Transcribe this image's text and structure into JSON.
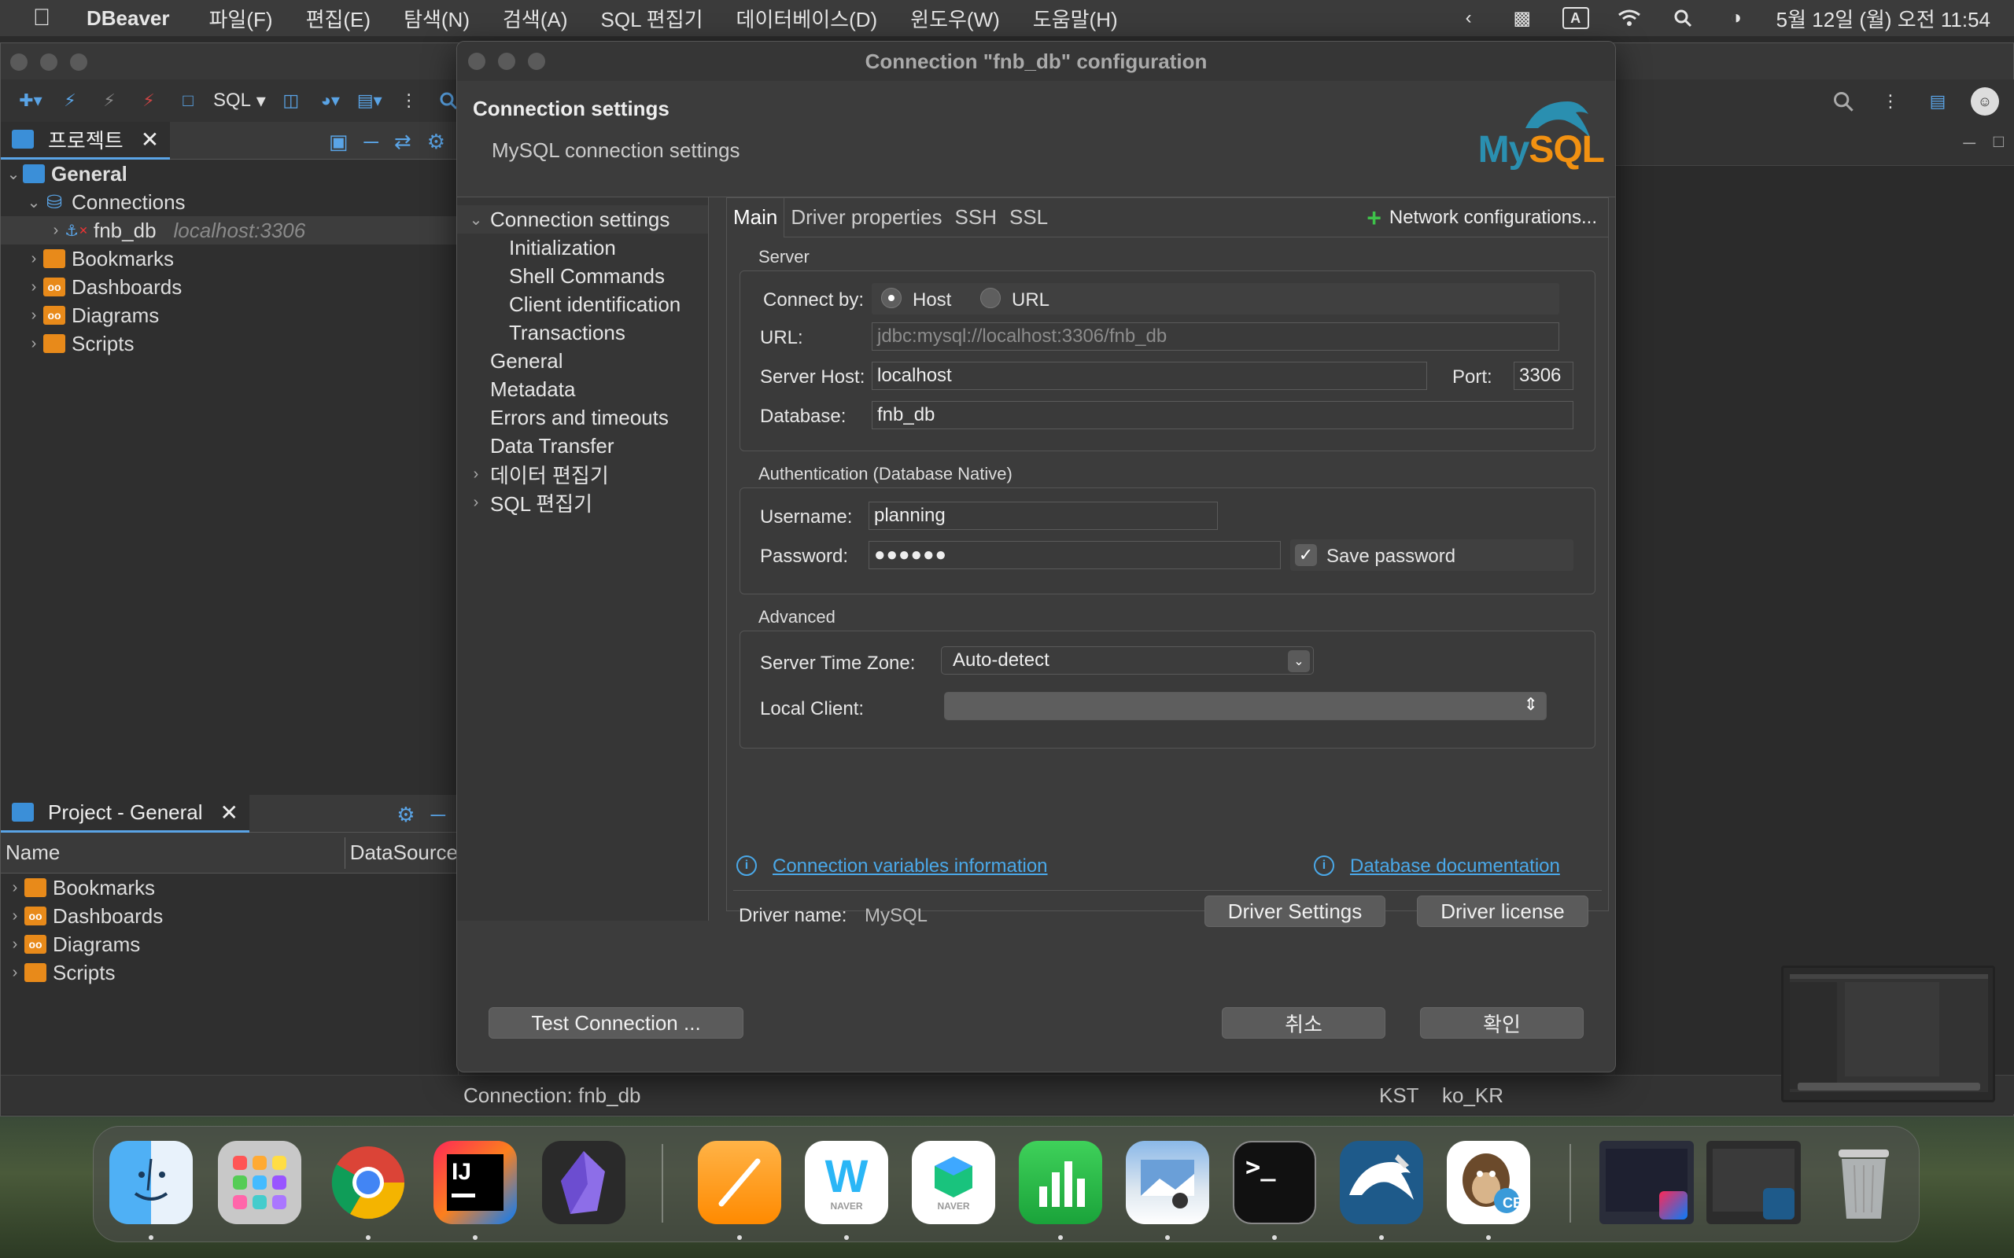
{
  "menubar": {
    "app_name": "DBeaver",
    "items": [
      "파일(F)",
      "편집(E)",
      "탐색(N)",
      "검색(A)",
      "SQL 편집기",
      "데이터베이스(D)",
      "윈도우(W)",
      "도움말(H)"
    ],
    "input_mode": "A",
    "clock": "5월 12일 (월) 오전 11:54"
  },
  "toolbar": {
    "sql_label": "SQL"
  },
  "project_panel": {
    "tab_label": "프로젝트",
    "tree": {
      "root": "General",
      "connections": "Connections",
      "connection_name": "fnb_db",
      "connection_host": "localhost:3306",
      "bookmarks": "Bookmarks",
      "dashboards": "Dashboards",
      "diagrams": "Diagrams",
      "scripts": "Scripts"
    },
    "folder_icon_text": "oo"
  },
  "project_general_panel": {
    "tab_label": "Project - General",
    "columns": [
      "Name",
      "DataSource"
    ],
    "items": [
      "Bookmarks",
      "Dashboards",
      "Diagrams",
      "Scripts"
    ]
  },
  "status_bar": {
    "connection": "Connection: fnb_db",
    "timezone": "KST",
    "locale": "ko_KR"
  },
  "dialog": {
    "title": "Connection \"fnb_db\" configuration",
    "header_title": "Connection settings",
    "header_subtitle": "MySQL connection settings",
    "logo_my": "My",
    "logo_sql": "SQL",
    "nav": {
      "connection_settings": "Connection settings",
      "initialization": "Initialization",
      "shell_commands": "Shell Commands",
      "client_identification": "Client identification",
      "transactions": "Transactions",
      "general": "General",
      "metadata": "Metadata",
      "errors_and_timeouts": "Errors and timeouts",
      "data_transfer": "Data Transfer",
      "data_editor": "데이터 편집기",
      "sql_editor": "SQL 편집기"
    },
    "tabs": [
      "Main",
      "Driver properties",
      "SSH",
      "SSL"
    ],
    "network_configurations": "Network configurations...",
    "server_group": {
      "label": "Server",
      "connect_by_label": "Connect by:",
      "host_option": "Host",
      "url_option": "URL",
      "url_label": "URL:",
      "url_value": "jdbc:mysql://localhost:3306/fnb_db",
      "server_host_label": "Server Host:",
      "server_host_value": "localhost",
      "port_label": "Port:",
      "port_value": "3306",
      "database_label": "Database:",
      "database_value": "fnb_db"
    },
    "auth_group": {
      "label": "Authentication (Database Native)",
      "username_label": "Username:",
      "username_value": "planning",
      "password_label": "Password:",
      "password_value": "●●●●●●",
      "save_password_label": "Save password",
      "save_password_checked": true
    },
    "advanced_group": {
      "label": "Advanced",
      "timezone_label": "Server Time Zone:",
      "timezone_value": "Auto-detect",
      "local_client_label": "Local Client:",
      "local_client_value": ""
    },
    "links": {
      "conn_vars": "Connection variables information",
      "db_docs": "Database documentation"
    },
    "driver": {
      "label": "Driver name:",
      "value": "MySQL",
      "settings_button": "Driver Settings",
      "license_button": "Driver license"
    },
    "buttons": {
      "test_connection": "Test Connection ...",
      "cancel": "취소",
      "ok": "확인"
    }
  },
  "dock": {
    "apps": [
      "Finder",
      "Launchpad",
      "Chrome",
      "IntelliJ IDEA",
      "Obsidian",
      "Pages",
      "Whale",
      "Naver",
      "Numbers",
      "Preview",
      "Terminal",
      "MySQL Workbench",
      "DBeaver CE"
    ],
    "labels": {
      "intellij": "IJ",
      "terminal": ">_",
      "dbeaver": "CE",
      "naver": "NAVER"
    }
  },
  "colors": {
    "accent_blue": "#4aa8e8",
    "mysql_blue": "#2a8fb0",
    "mysql_orange": "#f29111",
    "green_plus": "#3ec24a"
  }
}
